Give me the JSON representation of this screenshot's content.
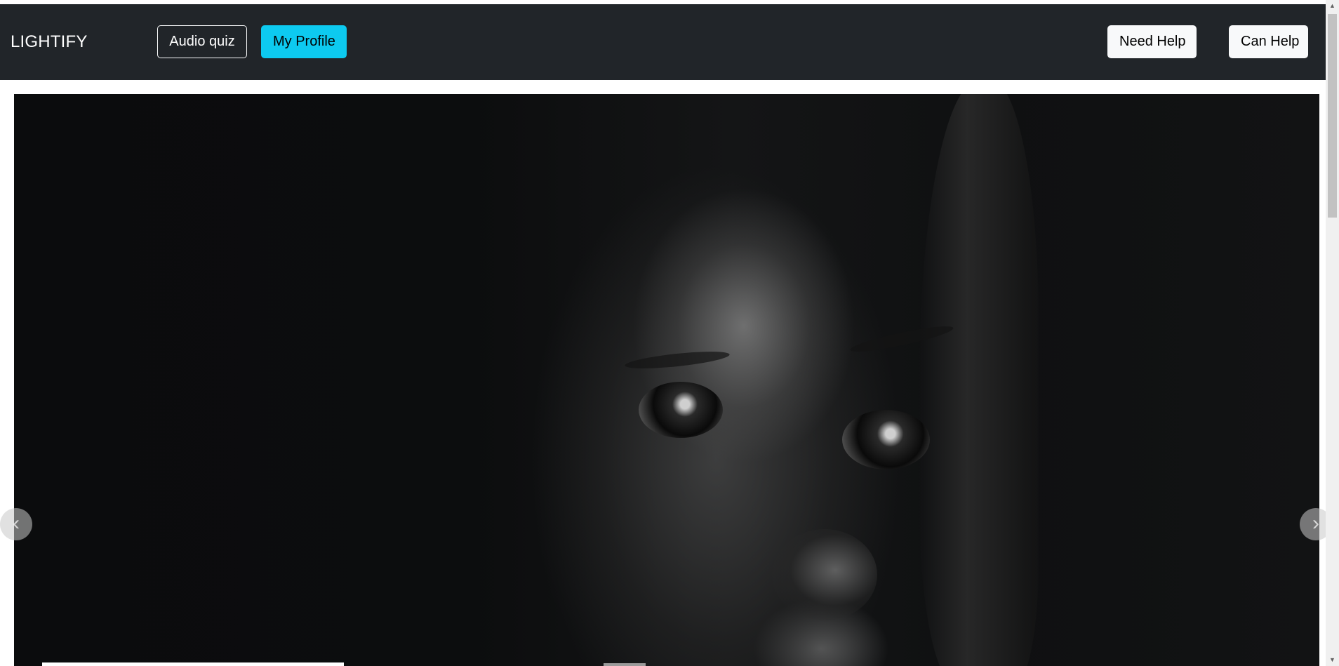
{
  "navbar": {
    "brand": "LIGHTIFY",
    "audio_quiz_label": "Audio quiz",
    "my_profile_label": "My Profile",
    "need_help_label": "Need Help",
    "can_help_label": "Can Help"
  },
  "carousel": {
    "prev_icon": "chevron-left-icon",
    "next_icon": "chevron-right-icon",
    "prev_glyph": "‹",
    "next_glyph": "›"
  },
  "scrollbar": {
    "up_glyph": "▲",
    "down_glyph": "▼"
  },
  "colors": {
    "navbar_bg": "#212529",
    "info_button": "#0dcaf0",
    "light_button": "#f8f9fa"
  }
}
